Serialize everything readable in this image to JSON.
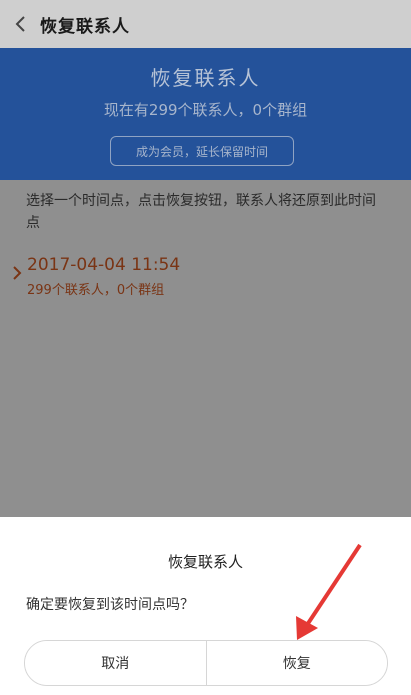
{
  "header": {
    "title": "恢复联系人",
    "back_icon": "chevron-left-icon"
  },
  "hero": {
    "title": "恢复联系人",
    "subtitle": "现在有299个联系人，0个群组",
    "member_button": "成为会员，延长保留时间"
  },
  "description": "选择一个时间点，点击恢复按钮，联系人将还原到此时间点",
  "snapshot": {
    "time": "2017-04-04 11:54",
    "count": "299个联系人，0个群组"
  },
  "dialog": {
    "title": "恢复联系人",
    "message": "确定要恢复到该时间点吗？",
    "cancel_label": "取消",
    "confirm_label": "恢复"
  },
  "colors": {
    "hero_bg": "#24529a",
    "accent_text": "#7a3414",
    "arrow": "#e53935"
  }
}
